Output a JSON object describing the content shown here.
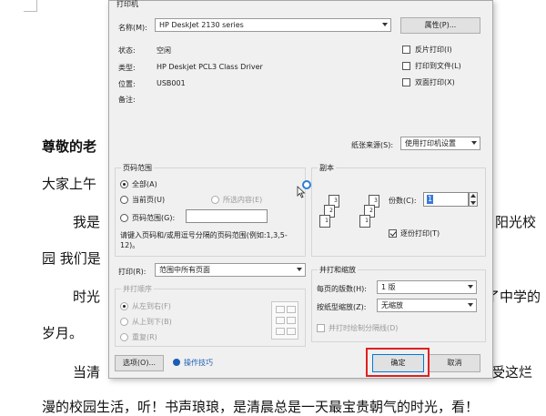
{
  "document": {
    "lines": [
      {
        "id": "greeting",
        "text": "尊敬的老"
      },
      {
        "id": "l1",
        "text": "大家上午"
      },
      {
        "id": "l2a",
        "text": "我是"
      },
      {
        "id": "l2b",
        "text": "阳光校"
      },
      {
        "id": "l3",
        "text": "园  我们是"
      },
      {
        "id": "l4a",
        "text": "时光"
      },
      {
        "id": "l4b",
        "text": "了中学的"
      },
      {
        "id": "l5",
        "text": "岁月。"
      },
      {
        "id": "l6a",
        "text": "当清"
      },
      {
        "id": "l6b",
        "text": "受这烂"
      },
      {
        "id": "l7",
        "text": "漫的校园生活，听！书声琅琅，是清晨总是一天最宝贵朝气的时光，看！"
      }
    ]
  },
  "dialog": {
    "printer_header": "打印机",
    "name_label": "名称(M):",
    "name_value": "HP DeskJet 2130 series",
    "properties_button": "属性(P)...",
    "status_label": "状态:",
    "status_value": "空闲",
    "type_label": "类型:",
    "type_value": "HP Deskjet PCL3 Class Driver",
    "location_label": "位置:",
    "location_value": "USB001",
    "comment_label": "备注:",
    "reverse_print": "反片打印(I)",
    "print_to_file": "打印到文件(L)",
    "duplex_print": "双面打印(X)",
    "paper_source_label": "纸张来源(S):",
    "paper_source_value": "使用打印机设置",
    "page_range": {
      "title": "页码范围",
      "all": "全部(A)",
      "current": "当前页(U)",
      "selection": "所选内容(E)",
      "pages": "页码范围(G):",
      "hint": "请键入页码和/或用逗号分隔的页码范围(例如:1,3,5-12)。"
    },
    "copies": {
      "title": "副本",
      "count_label": "份数(C):",
      "count_value": "1",
      "collate": "逐份打印(T)"
    },
    "print_label": "打印(R):",
    "print_value": "范围中所有页面",
    "print_order": {
      "title": "并打顺序",
      "left_to_right": "从左到右(F)",
      "top_to_bottom": "从上到下(B)",
      "repeat": "重复(R)"
    },
    "zoom": {
      "title": "并打和缩放",
      "pages_per_sheet_label": "每页的版数(H):",
      "pages_per_sheet_value": "1 版",
      "scale_label": "按纸型缩放(Z):",
      "scale_value": "无缩放",
      "draw_border": "并打时绘制分隔线(D)"
    },
    "options_button": "选项(O)...",
    "tips_link": "操作技巧",
    "ok_button": "确定",
    "cancel_button": "取消"
  },
  "colors": {
    "highlight": "#e02020",
    "link": "#1a5fb4",
    "dialog_bg": "#f0f0f0"
  }
}
